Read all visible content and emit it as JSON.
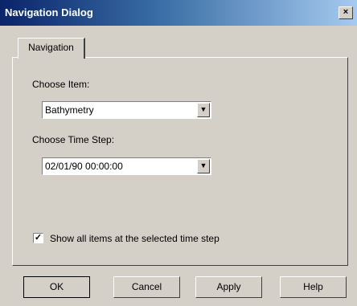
{
  "window": {
    "title": "Navigation Dialog",
    "close_glyph": "×"
  },
  "tabs": [
    {
      "label": "Navigation"
    }
  ],
  "item": {
    "label": "Choose Item:",
    "value": "Bathymetry"
  },
  "time_step": {
    "label": "Choose Time Step:",
    "value": "02/01/90 00:00:00"
  },
  "show_all": {
    "label": "Show all items at the selected time step",
    "checked": true
  },
  "buttons": {
    "ok": "OK",
    "cancel": "Cancel",
    "apply": "Apply",
    "help": "Help"
  },
  "colors": {
    "face": "#d4d0c8",
    "title_start": "#0a246a",
    "title_end": "#a6caf0"
  }
}
